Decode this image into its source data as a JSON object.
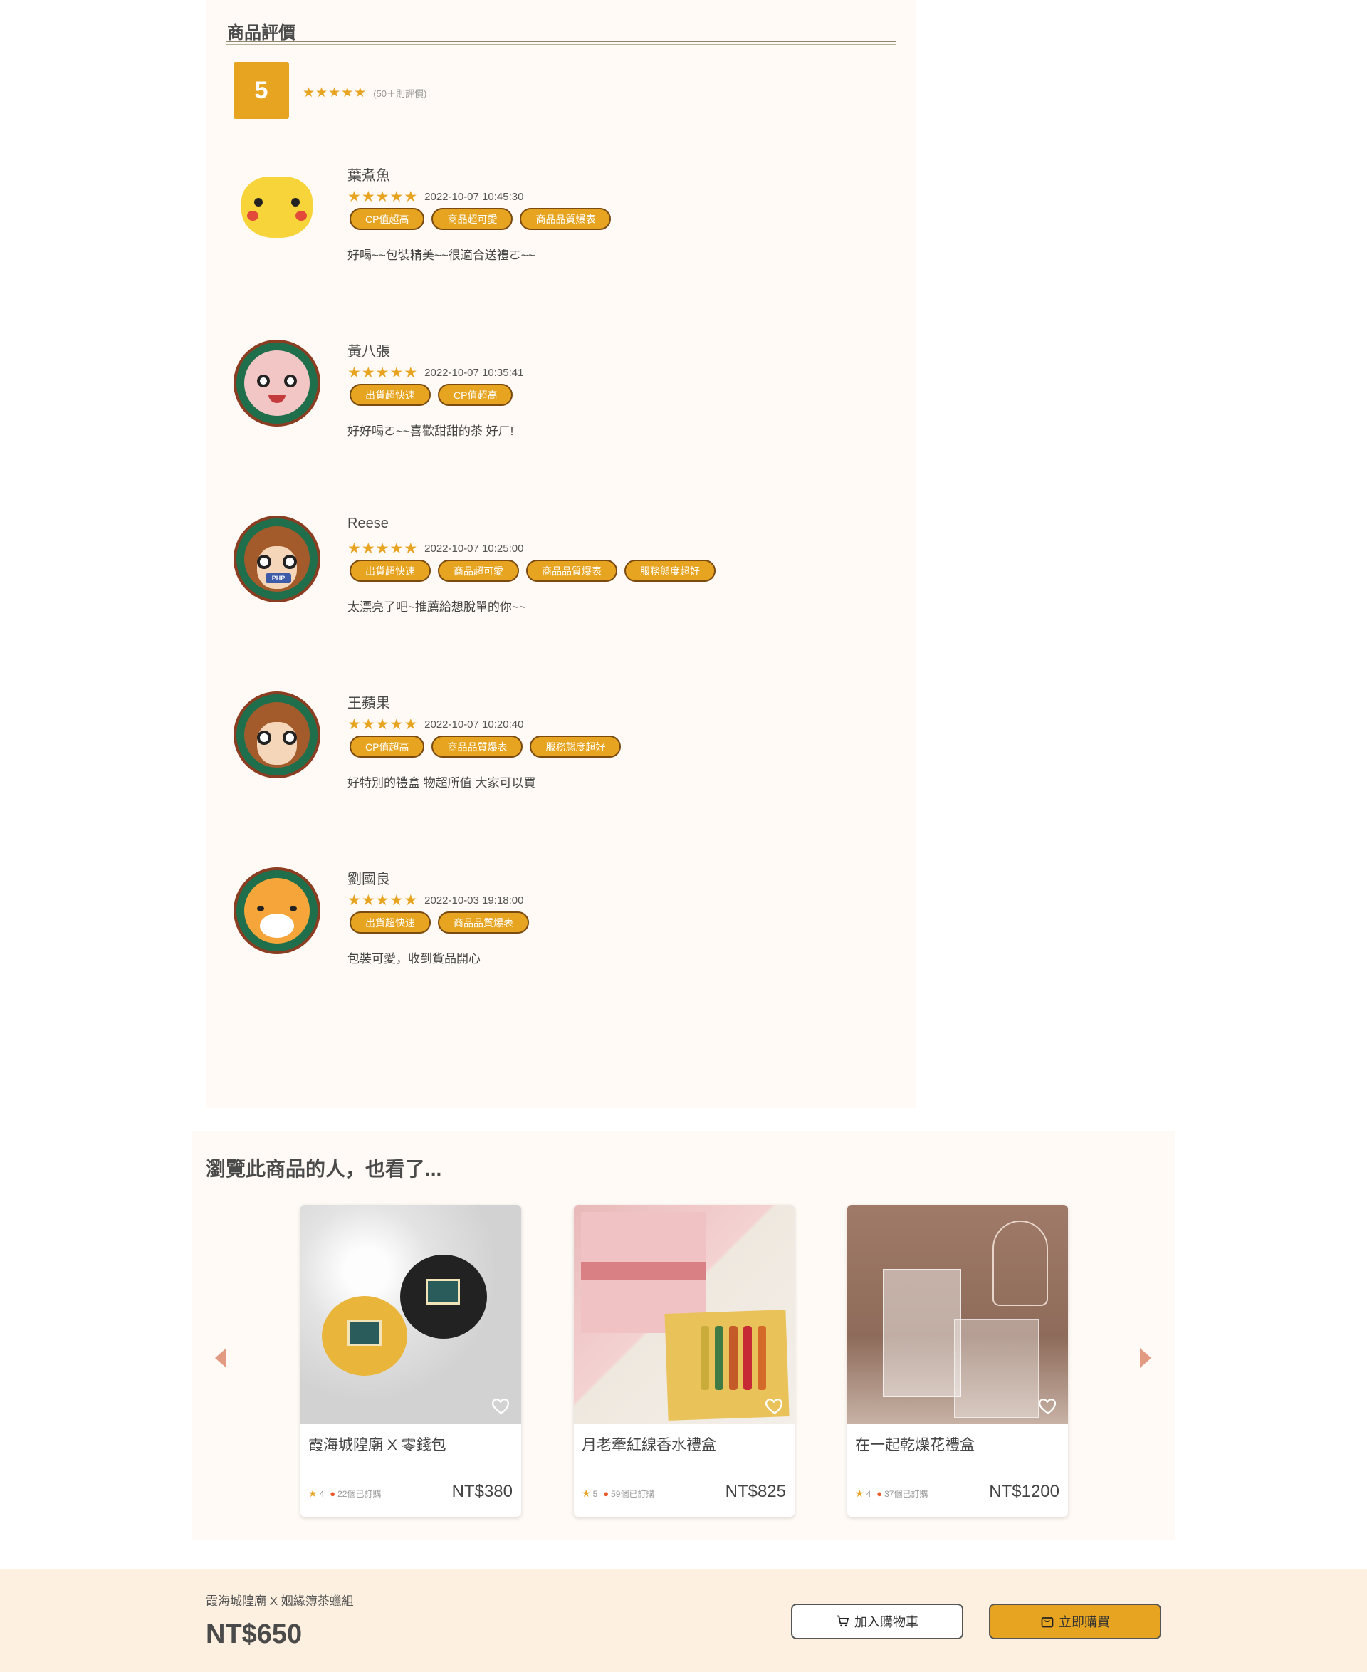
{
  "reviews": {
    "title": "商品評價",
    "score": "5",
    "count_text": "(50＋則評價)",
    "star_glyph": "★",
    "accent_color": "#e6a421",
    "items": [
      {
        "name": "葉煮魚",
        "date": "2022-10-07 10:45:30",
        "tags": [
          "CP值超高",
          "商品超可愛",
          "商品品質爆表"
        ],
        "text": "好喝~~包裝精美~~很適合送禮ㄛ~~",
        "rating": 5
      },
      {
        "name": "黃八張",
        "date": "2022-10-07 10:35:41",
        "tags": [
          "出貨超快速",
          "CP值超高"
        ],
        "text": "好好喝ㄛ~~喜歡甜甜的茶 好ㄏ!",
        "rating": 5
      },
      {
        "name": "Reese",
        "date": "2022-10-07 10:25:00",
        "tags": [
          "出貨超快速",
          "商品超可愛",
          "商品品質爆表",
          "服務態度超好"
        ],
        "text": "太漂亮了吧~推薦給想脫單的你~~",
        "rating": 5
      },
      {
        "name": "王蘋果",
        "date": "2022-10-07 10:20:40",
        "tags": [
          "CP值超高",
          "商品品質爆表",
          "服務態度超好"
        ],
        "text": "好特別的禮盒 物超所值 大家可以買",
        "rating": 5
      },
      {
        "name": "劉國良",
        "date": "2022-10-03 19:18:00",
        "tags": [
          "出貨超快速",
          "商品品質爆表"
        ],
        "text": "包裝可愛，收到貨品開心",
        "rating": 5
      }
    ]
  },
  "also_viewed": {
    "title": "瀏覽此商品的人，也看了...",
    "products": [
      {
        "name": "霞海城隍廟 X 零錢包",
        "rating": "4",
        "sold": "22個已訂購",
        "price": "NT$380"
      },
      {
        "name": "月老牽紅線香水禮盒",
        "rating": "5",
        "sold": "59個已訂購",
        "price": "NT$825"
      },
      {
        "name": "在一起乾燥花禮盒",
        "rating": "4",
        "sold": "37個已訂購",
        "price": "NT$1200"
      }
    ]
  },
  "bottom_bar": {
    "product_name": "霞海城隍廟 X 姻緣簿茶蠟組",
    "price": "NT$650",
    "add_to_cart": "加入購物車",
    "buy_now": "立即購買"
  }
}
